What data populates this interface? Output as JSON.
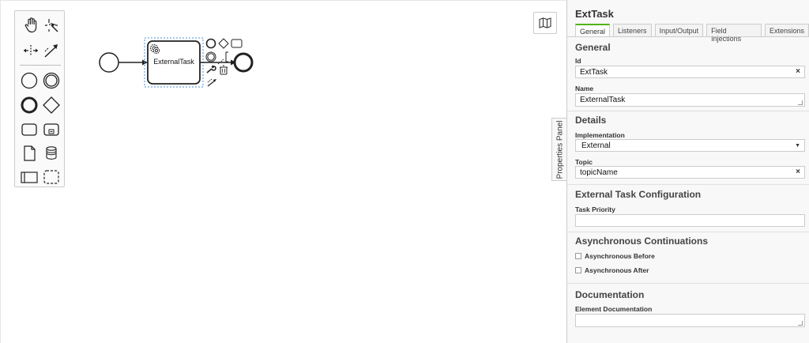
{
  "palette": {
    "tools": [
      {
        "name": "hand-tool-icon"
      },
      {
        "name": "lasso-tool-icon"
      },
      {
        "name": "space-tool-icon"
      },
      {
        "name": "global-connect-tool-icon"
      },
      {
        "name": "start-event-icon"
      },
      {
        "name": "intermediate-event-icon"
      },
      {
        "name": "end-event-icon"
      },
      {
        "name": "gateway-icon"
      },
      {
        "name": "task-icon"
      },
      {
        "name": "subprocess-icon"
      },
      {
        "name": "data-object-icon"
      },
      {
        "name": "data-store-icon"
      },
      {
        "name": "pool-icon"
      },
      {
        "name": "group-icon"
      }
    ]
  },
  "diagram": {
    "task_label": "ExternalTask"
  },
  "props_toggle_label": "Properties Panel",
  "panel": {
    "title": "ExtTask",
    "tabs": [
      "General",
      "Listeners",
      "Input/Output",
      "Field Injections",
      "Extensions"
    ],
    "active_tab": "General",
    "general": {
      "title": "General",
      "id_label": "Id",
      "id_value": "ExtTask",
      "name_label": "Name",
      "name_value": "ExternalTask"
    },
    "details": {
      "title": "Details",
      "implementation_label": "Implementation",
      "implementation_value": "External",
      "topic_label": "Topic",
      "topic_value": "topicName"
    },
    "external_task": {
      "title": "External Task Configuration",
      "priority_label": "Task Priority",
      "priority_value": ""
    },
    "async": {
      "title": "Asynchronous Continuations",
      "before_label": "Asynchronous Before",
      "after_label": "Asynchronous After"
    },
    "documentation": {
      "title": "Documentation",
      "doc_label": "Element Documentation",
      "doc_value": ""
    },
    "clear_symbol": "×",
    "select_arrow": "▼"
  },
  "colors": {
    "accent": "#52b415",
    "selection": "#4b8dd6"
  }
}
